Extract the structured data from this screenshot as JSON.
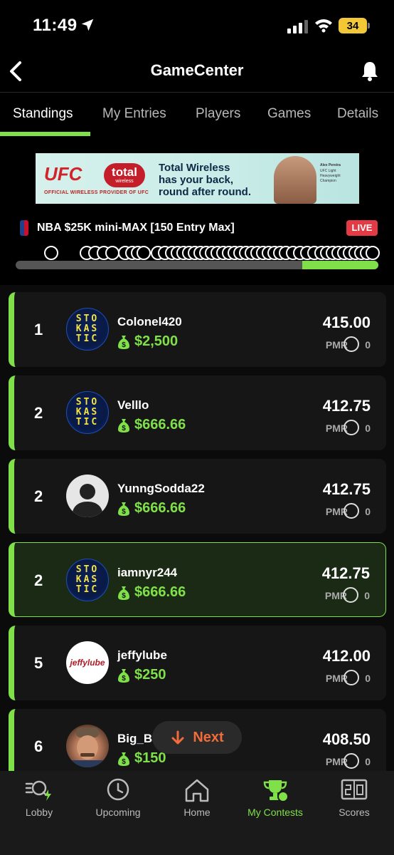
{
  "status_bar": {
    "time": "11:49",
    "battery": "34"
  },
  "header": {
    "title": "GameCenter"
  },
  "tabs": [
    {
      "label": "Standings",
      "active": true
    },
    {
      "label": "My Entries"
    },
    {
      "label": "Players"
    },
    {
      "label": "Games"
    },
    {
      "label": "Details"
    }
  ],
  "ad": {
    "brand1": "UFC",
    "brand2": "total",
    "brand2_sub": "wireless",
    "tagline_small": "OFFICIAL WIRELESS PROVIDER OF UFC",
    "headline_line1": "Total Wireless",
    "headline_line2": "has your back,",
    "headline_line3": "round after round.",
    "caption1": "Alex Pereira",
    "caption2": "UFC Light",
    "caption3": "Heavyweight",
    "caption4": "Champion"
  },
  "contest": {
    "name": "NBA $25K mini-MAX [150 Entry Max]",
    "status": "LIVE",
    "progress": 0.21
  },
  "entries": [
    {
      "rank": "1",
      "username": "Colonel420",
      "winnings": "$2,500",
      "score": "415.00",
      "pmr_label": "PMR",
      "pmr": "0",
      "avatar": "stokastic"
    },
    {
      "rank": "2",
      "username": "Velllo",
      "winnings": "$666.66",
      "score": "412.75",
      "pmr_label": "PMR",
      "pmr": "0",
      "avatar": "stokastic"
    },
    {
      "rank": "2",
      "username": "YunngSodda22",
      "winnings": "$666.66",
      "score": "412.75",
      "pmr_label": "PMR",
      "pmr": "0",
      "avatar": "blank"
    },
    {
      "rank": "2",
      "username": "iamnyr244",
      "winnings": "$666.66",
      "score": "412.75",
      "pmr_label": "PMR",
      "pmr": "0",
      "avatar": "stokastic",
      "highlighted": true
    },
    {
      "rank": "5",
      "username": "jeffylube",
      "winnings": "$250",
      "score": "412.00",
      "pmr_label": "PMR",
      "pmr": "0",
      "avatar": "jeffy"
    },
    {
      "rank": "6",
      "username": "Big_Ba",
      "winnings": "$150",
      "score": "408.50",
      "pmr_label": "PMR",
      "pmr": "0",
      "avatar": "photo"
    }
  ],
  "avatar_texts": {
    "stokastic": "STO\nKAS\nTIC",
    "jeffy": "jeffylube"
  },
  "next_button": {
    "label": "Next"
  },
  "bottom_nav": [
    {
      "label": "Lobby",
      "icon": "lobby-icon"
    },
    {
      "label": "Upcoming",
      "icon": "clock-icon"
    },
    {
      "label": "Home",
      "icon": "home-icon"
    },
    {
      "label": "My Contests",
      "icon": "trophy-icon",
      "active": true
    },
    {
      "label": "Scores",
      "icon": "scoreboard-icon"
    }
  ],
  "colors": {
    "accent": "#7fe04a",
    "live": "#e23b45",
    "next": "#f26b3a"
  }
}
